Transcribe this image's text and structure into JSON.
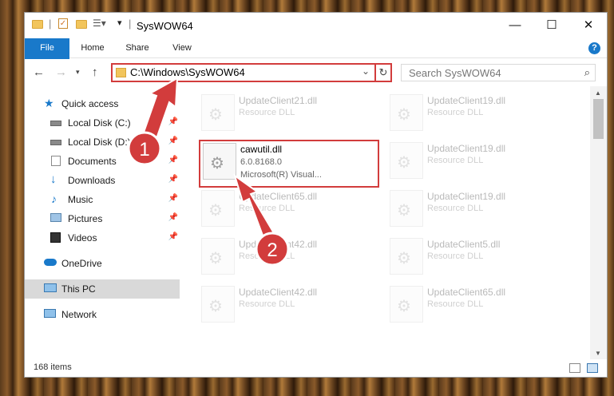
{
  "window": {
    "title": "SysWOW64",
    "minimize": "—",
    "maximize": "☐",
    "close": "✕"
  },
  "ribbon": {
    "tabs": [
      {
        "label": "File"
      },
      {
        "label": "Home"
      },
      {
        "label": "Share"
      },
      {
        "label": "View"
      }
    ],
    "help": "?"
  },
  "nav": {
    "address": "C:\\Windows\\SysWOW64",
    "search_placeholder": "Search SysWOW64"
  },
  "sidebar": {
    "items": [
      {
        "label": "Quick access",
        "icon": "star-icon"
      },
      {
        "label": "Local Disk (C:)",
        "icon": "drive-icon"
      },
      {
        "label": "Local Disk (D:)",
        "icon": "drive-icon"
      },
      {
        "label": "Documents",
        "icon": "documents-icon"
      },
      {
        "label": "Downloads",
        "icon": "download-icon"
      },
      {
        "label": "Music",
        "icon": "music-icon"
      },
      {
        "label": "Pictures",
        "icon": "pictures-icon"
      },
      {
        "label": "Videos",
        "icon": "videos-icon"
      },
      {
        "label": "OneDrive",
        "icon": "cloud-icon"
      },
      {
        "label": "This PC",
        "icon": "computer-icon"
      },
      {
        "label": "Network",
        "icon": "network-icon"
      }
    ]
  },
  "files": {
    "highlighted": {
      "name": "cawutil.dll",
      "version": "6.0.8168.0",
      "company": "Microsoft(R) Visual..."
    },
    "left_column": [
      {
        "name": "UpdateClient21.dll",
        "type": "Resource DLL"
      },
      {
        "name": "UpdateClient65.dll",
        "type": "Resource DLL"
      },
      {
        "name": "UpdateClient42.dll",
        "type": "Resource DLL"
      },
      {
        "name": "UpdateClient42.dll",
        "type": "Resource DLL"
      }
    ],
    "right_column": [
      {
        "name": "UpdateClient19.dll",
        "type": "Resource DLL"
      },
      {
        "name": "UpdateClient19.dll",
        "type": "Resource DLL"
      },
      {
        "name": "UpdateClient19.dll",
        "type": "Resource DLL"
      },
      {
        "name": "UpdateClient5.dll",
        "type": "Resource DLL"
      },
      {
        "name": "UpdateClient65.dll",
        "type": "Resource DLL"
      }
    ]
  },
  "status": {
    "count": "168 items"
  },
  "annotations": {
    "step1": "1",
    "step2": "2",
    "color": "#d23c3c"
  }
}
